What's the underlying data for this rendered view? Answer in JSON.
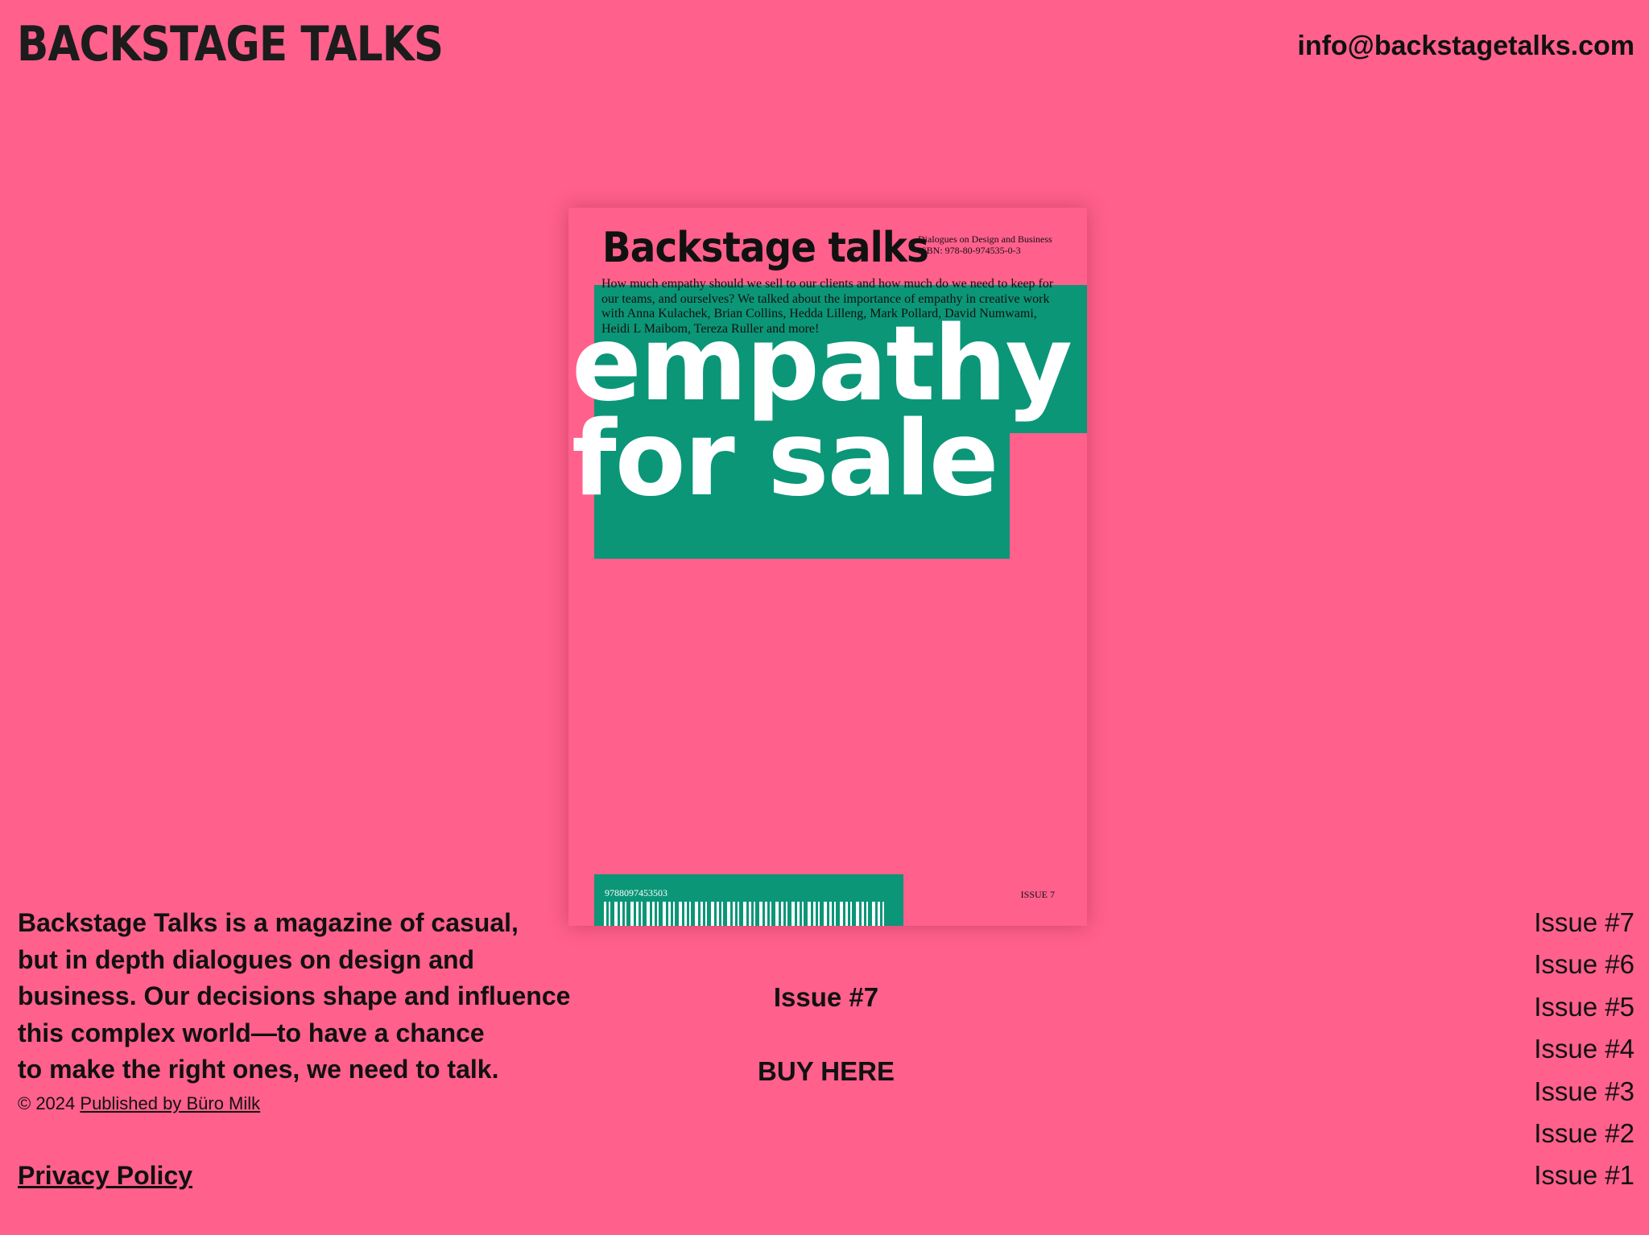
{
  "header": {
    "logo": "BACKSTAGE TALKS",
    "email": "info@backstagetalks.com"
  },
  "cover": {
    "brand": "Backstage talks",
    "meta_line1": "Dialogues on Design and Business",
    "meta_line2": "ISBN: 978-80-974535-0-3",
    "description": "How much empathy should we sell to our clients and how much do we need to keep for our teams, and ourselves? We talked about the importance of empathy in creative work with Anna Kulachek, Brian Collins, Hedda Lilleng, Mark Pollard, David Numwami, Heidi L Maibom, Tereza Ruller and more!",
    "headline_line1": "empathy",
    "headline_line2": "for sale",
    "barcode_number": "9788097453503",
    "issue_label": "ISSUE 7",
    "colors": {
      "background": "#ff608c",
      "accent": "#0b9678"
    }
  },
  "main": {
    "current_issue": "Issue #7",
    "buy_label": "BUY HERE"
  },
  "footer": {
    "about": "Backstage Talks is a magazine of casual,\nbut in depth dialogues on design and\nbusiness. Our decisions shape and influence\nthis complex world—to have a chance\nto make the right ones, we need to talk.",
    "copyright_prefix": "© 2024",
    "publisher_link": "Published by Büro Milk",
    "privacy_link": "Privacy Policy"
  },
  "issues": [
    {
      "label": "Issue #7"
    },
    {
      "label": "Issue #6"
    },
    {
      "label": "Issue #5"
    },
    {
      "label": "Issue #4"
    },
    {
      "label": "Issue #3"
    },
    {
      "label": "Issue #2"
    },
    {
      "label": "Issue #1"
    }
  ]
}
